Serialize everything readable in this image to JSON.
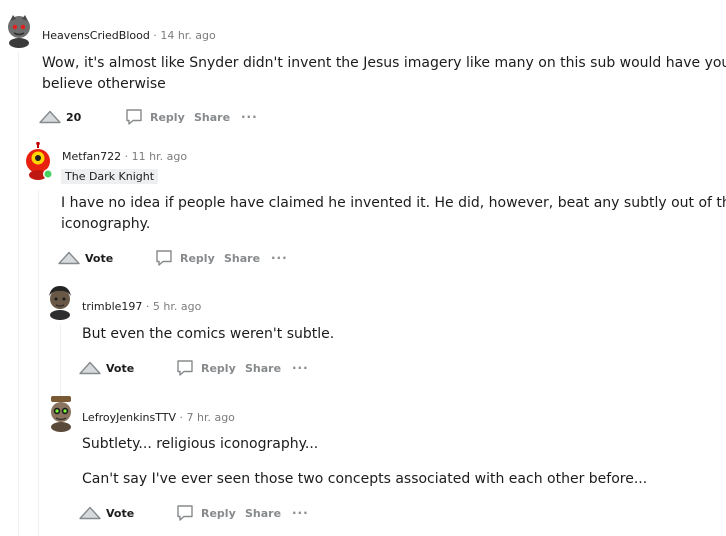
{
  "comments": [
    {
      "author": "HeavensCriedBlood",
      "time": "14 hr. ago",
      "body": [
        "Wow, it's almost like Snyder didn't invent the Jesus imagery like many on this sub would have you",
        "believe otherwise"
      ],
      "vote": "20",
      "reply": "Reply",
      "share": "Share",
      "more": "···"
    },
    {
      "author": "Metfan722",
      "time": "11 hr. ago",
      "flair": "The Dark Knight",
      "body": [
        "I have no idea if people have claimed he invented it. He did, however, beat any subtly out of the",
        "iconography."
      ],
      "vote": "Vote",
      "reply": "Reply",
      "share": "Share",
      "more": "···"
    },
    {
      "author": "trimble197",
      "time": "5 hr. ago",
      "body": [
        "But even the comics weren't subtle."
      ],
      "vote": "Vote",
      "reply": "Reply",
      "share": "Share",
      "more": "···"
    },
    {
      "author": "LefroyJenkinsTTV",
      "time": "7 hr. ago",
      "body": [
        "Subtlety... religious iconography...",
        "Can't say I've ever seen those two concepts associated with each other before..."
      ],
      "vote": "Vote",
      "reply": "Reply",
      "share": "Share",
      "more": "···"
    }
  ],
  "separator": "·"
}
